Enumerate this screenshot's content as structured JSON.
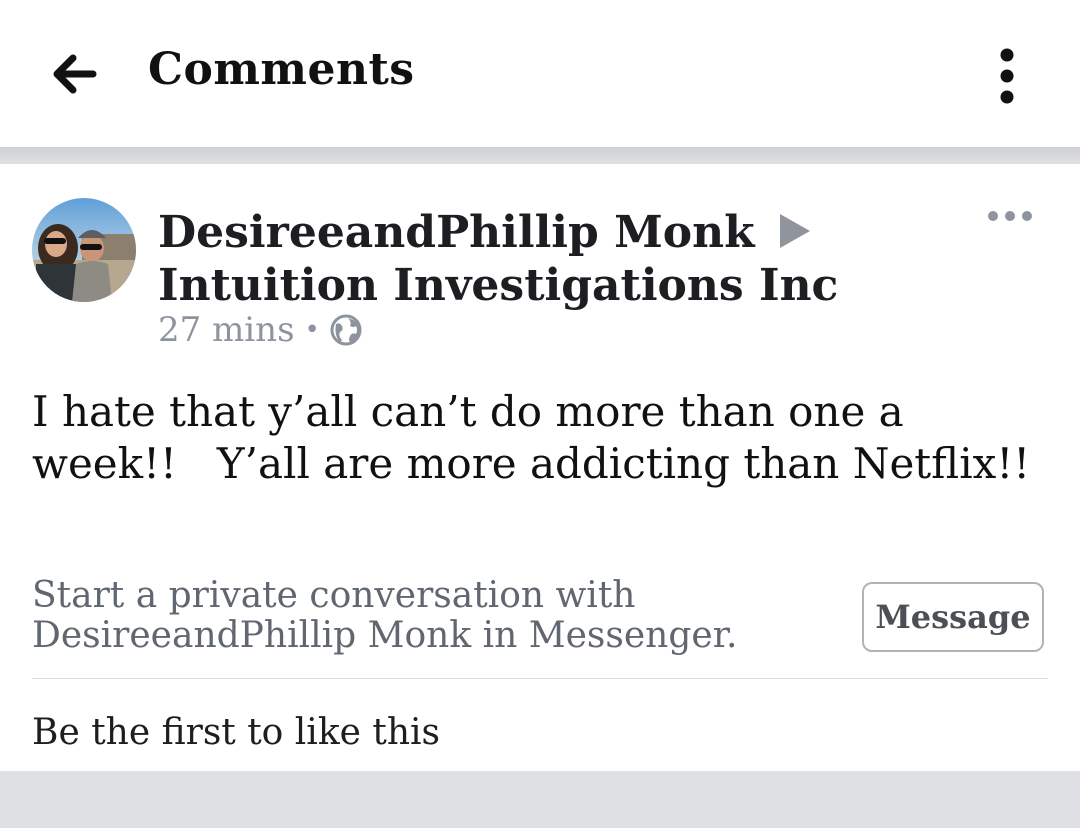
{
  "header": {
    "title": "Comments",
    "back_icon": "back-arrow-icon",
    "menu_icon": "kebab-menu-icon"
  },
  "post": {
    "author": "DesireeandPhillip Monk",
    "target_page": "Intuition Investigations Inc",
    "timestamp": "27 mins",
    "separator": "•",
    "privacy_icon": "globe-icon",
    "more_icon": "ellipsis-icon",
    "text": "I hate that y’all can’t do more than one a week!!   Y’all are more addicting than Netflix!!"
  },
  "messenger": {
    "prompt": "Start a private conversation with DesireeandPhillip Monk in Messenger.",
    "button_label": "Message"
  },
  "reactions": {
    "likes_text": "Be the first to like this"
  },
  "colors": {
    "page_background": "#dfe0e4",
    "card_background": "#ffffff",
    "primary_text": "#1c1e21",
    "secondary_text": "#8d949e",
    "arrow_gray": "#90949c"
  }
}
